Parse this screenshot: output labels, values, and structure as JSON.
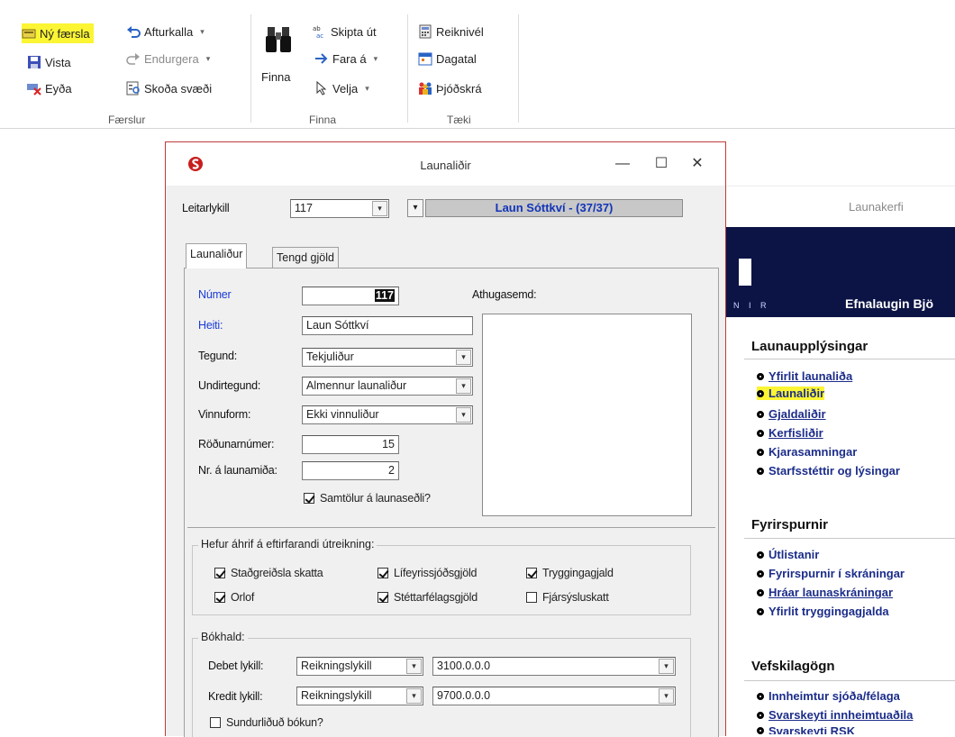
{
  "ribbon": {
    "group_faerslur": {
      "label": "Færslur",
      "ny_faersla": "Ný færsla",
      "vista": "Vista",
      "eyda": "Eyða",
      "afturkalla": "Afturkalla",
      "endurgera": "Endurgera",
      "skoda_svaedi": "Skoða svæði"
    },
    "group_finna": {
      "label": "Finna",
      "finna": "Finna",
      "skipta_ut": "Skipta út",
      "fara_a": "Fara á",
      "velja": "Velja"
    },
    "group_taeki": {
      "label": "Tæki",
      "reiknivel": "Reiknivél",
      "dagatal": "Dagatal",
      "thjodskra": "Þjóðskrá"
    },
    "highlight_color": "#fbf534"
  },
  "background_app": {
    "header_title": "Launakerfi",
    "banner_logo_sub": "N I R",
    "banner_company": "Efnalaugin Bjö",
    "sections": [
      {
        "title": "Launaupplýsingar",
        "items": [
          "Yfirlit launaliða",
          "Launaliðir",
          "Gjaldaliðir",
          "Kerfisliðir",
          "Kjarasamningar",
          "Starfsstéttir og lýsingar"
        ]
      },
      {
        "title": "Fyrirspurnir",
        "items": [
          "Útlistanir",
          "Fyrirspurnir í skráningar",
          "Hráar launaskráningar",
          "Yfirlit tryggingagjalda"
        ]
      },
      {
        "title": "Vefskilagögn",
        "items": [
          "Innheimtur sjóða/félaga",
          "Svarskeyti innheimtuaðila",
          "Svarskeyti RSK"
        ]
      }
    ],
    "link_color": "#1c2d8a",
    "banner_color": "#0c1446"
  },
  "dialog": {
    "title": "Launaliðir",
    "leitarlykill_label": "Leitarlykill",
    "leitarlykill_value": "117",
    "readout": "Laun Sóttkví  -   (37/37)",
    "tabs": [
      "Launaliður",
      "Tengd gjöld"
    ],
    "fields": {
      "numer_label": "Númer",
      "numer_value": "117",
      "heiti_label": "Heiti:",
      "heiti_value": "Laun Sóttkví",
      "tegund_label": "Tegund:",
      "tegund_value": "Tekjuliður",
      "undirtegund_label": "Undirtegund:",
      "undirtegund_value": "Almennur launaliður",
      "vinnuform_label": "Vinnuform:",
      "vinnuform_value": "Ekki vinnuliður",
      "rodunarnumer_label": "Röðunarnúmer:",
      "rodunarnumer_value": "15",
      "nr_launamida_label": "Nr. á launamiða:",
      "nr_launamida_value": "2",
      "samtolur_label": "Samtölur á launaseðli?",
      "athugasemd_label": "Athugasemd:"
    },
    "effects": {
      "title": "Hefur áhrif á eftirfarandi útreikning:",
      "stadgreidsla": "Staðgreiðsla skatta",
      "orlof": "Orlof",
      "lifeyrissjodsgjold": "Lífeyrissjóðsgjöld",
      "stettarfelagsgjold": "Stéttarfélagsgjöld",
      "tryggingagjald": "Tryggingagjald",
      "fjarsysluskatt": "Fjársýsluskatt"
    },
    "bokhald": {
      "title": "Bókhald:",
      "debet_label": "Debet lykill:",
      "debet_type": "Reikningslykill",
      "debet_value": "3100.0.0.0",
      "kredit_label": "Kredit lykill:",
      "kredit_type": "Reikningslykill",
      "kredit_value": "9700.0.0.0",
      "sundurlidud_label": "Sundurliðuð bókun?"
    },
    "border_color": "#c03a3a",
    "label_blue": "#1a3bd6",
    "readout_color": "#1235b8"
  }
}
